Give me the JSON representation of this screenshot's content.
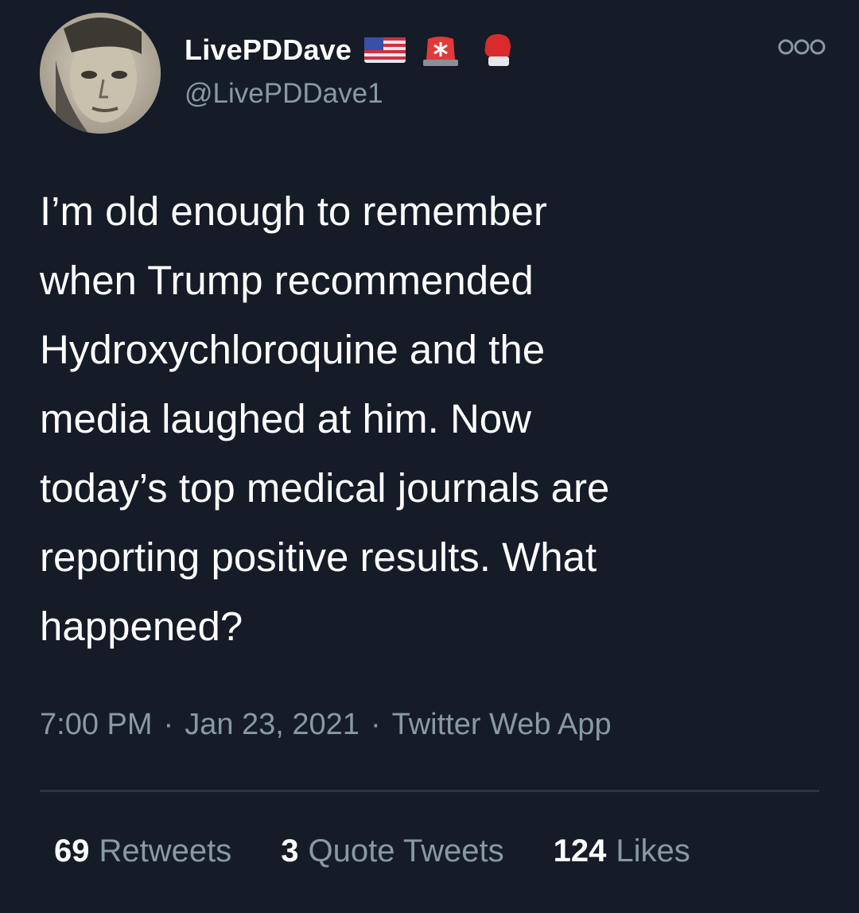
{
  "user": {
    "display_name": "LivePDDave",
    "handle": "@LivePDDave1",
    "badges": [
      "us-flag-icon",
      "police-light-icon",
      "boxing-glove-icon"
    ]
  },
  "tweet": {
    "text": "I’m old enough to remember\nwhen Trump recommended\nHydroxychloroquine and the\nmedia laughed at him. Now\ntoday’s top medical journals are\nreporting positive results. What\nhappened?",
    "time": "7:00 PM",
    "date": "Jan 23, 2021",
    "source": "Twitter Web App",
    "separator": "·"
  },
  "stats": {
    "retweets_count": "69",
    "retweets_label": "Retweets",
    "quotes_count": "3",
    "quotes_label": "Quote Tweets",
    "likes_count": "124",
    "likes_label": "Likes"
  },
  "colors": {
    "background": "#151c27",
    "primary_text": "#ffffff",
    "secondary_text": "#8899a6",
    "divider": "#2c3540"
  }
}
